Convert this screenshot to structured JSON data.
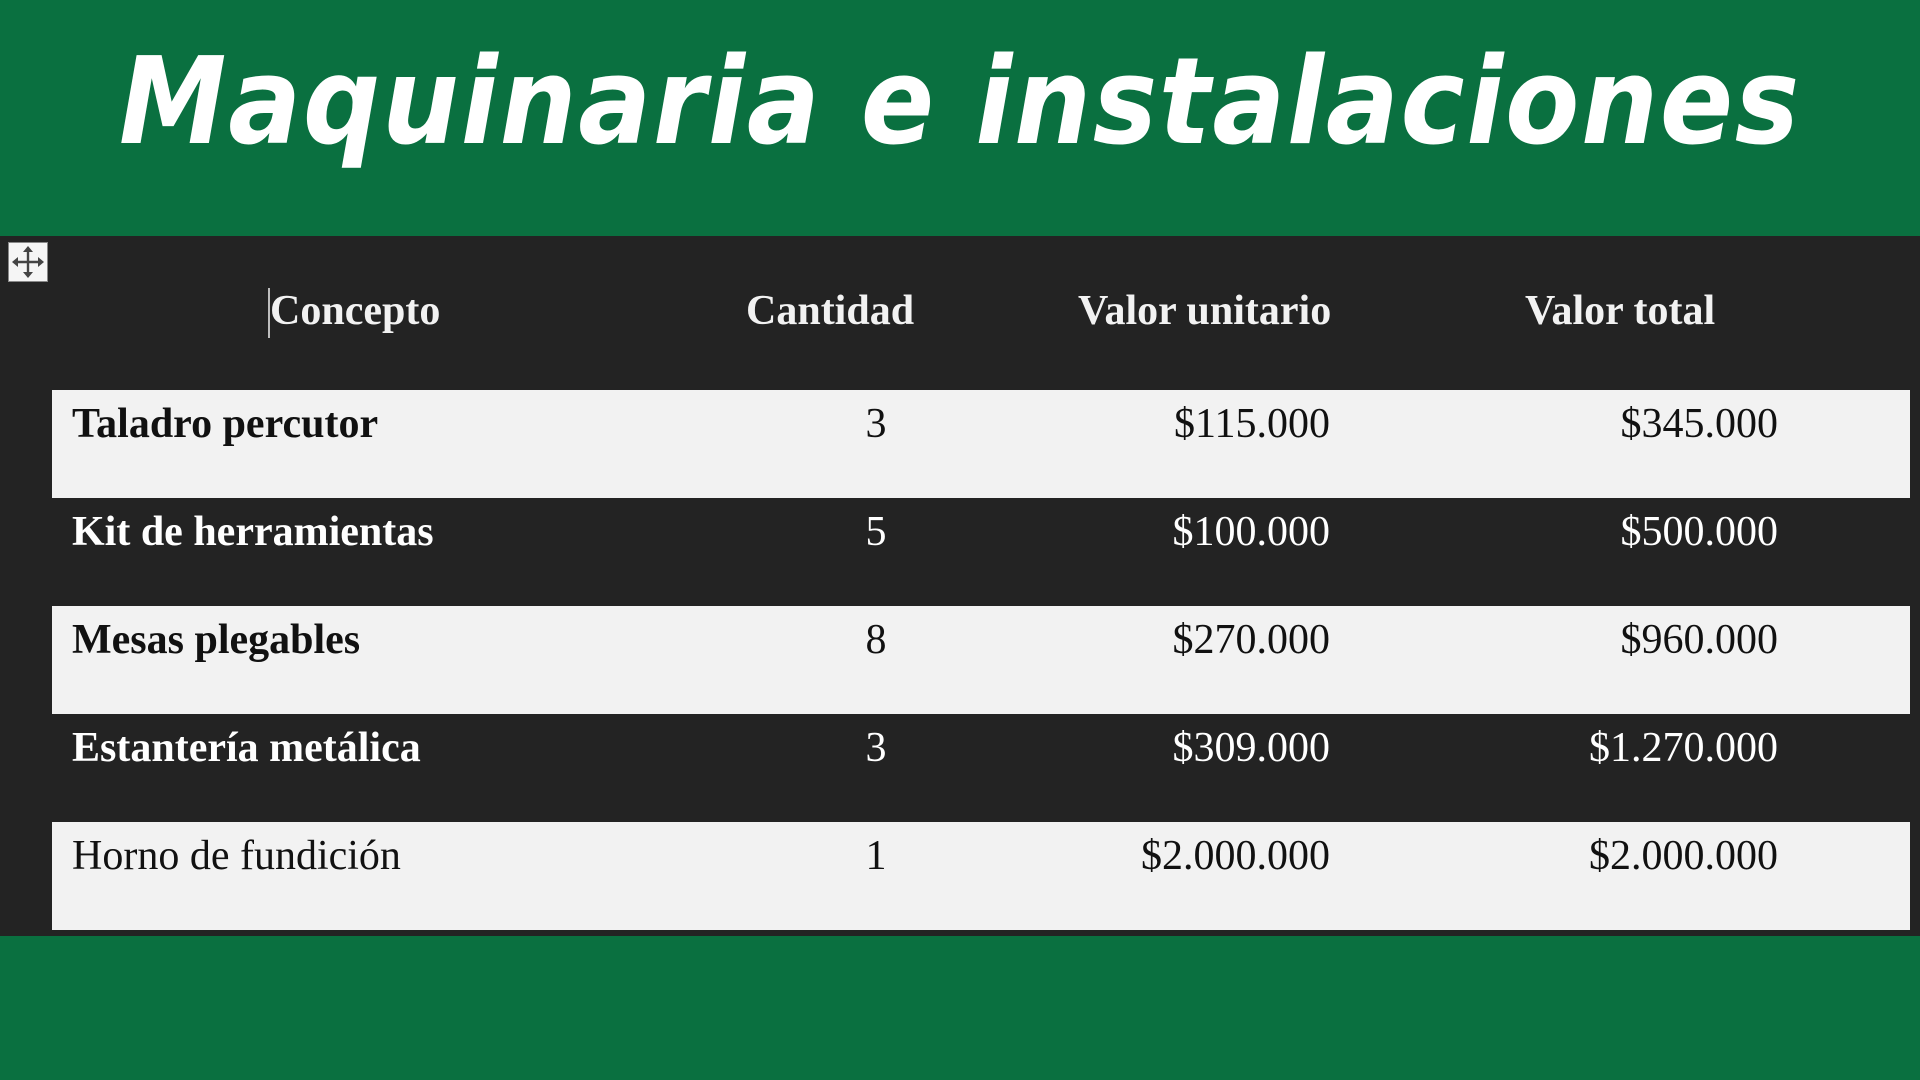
{
  "title": "Maquinaria e instalaciones",
  "table": {
    "headers": {
      "concept": "Concepto",
      "quantity": "Cantidad",
      "unit_value": "Valor unitario",
      "total_value": "Valor total"
    },
    "rows": [
      {
        "concept": "Taladro percutor",
        "quantity": "3",
        "unit_value": "$115.000",
        "total_value": "$345.000"
      },
      {
        "concept": "Kit de herramientas",
        "quantity": "5",
        "unit_value": "$100.000",
        "total_value": "$500.000"
      },
      {
        "concept": "Mesas plegables",
        "quantity": "8",
        "unit_value": "$270.000",
        "total_value": "$960.000"
      },
      {
        "concept": "Estantería metálica",
        "quantity": "3",
        "unit_value": "$309.000",
        "total_value": "$1.270.000"
      },
      {
        "concept": "Horno de fundición",
        "quantity": "1",
        "unit_value": "$2.000.000",
        "total_value": "$2.000.000"
      }
    ]
  },
  "icons": {
    "move_handle": "move-icon"
  },
  "colors": {
    "background": "#0a7040",
    "table_dark": "#232323",
    "table_light": "#f2f2f2",
    "title_text": "#ffffff"
  }
}
